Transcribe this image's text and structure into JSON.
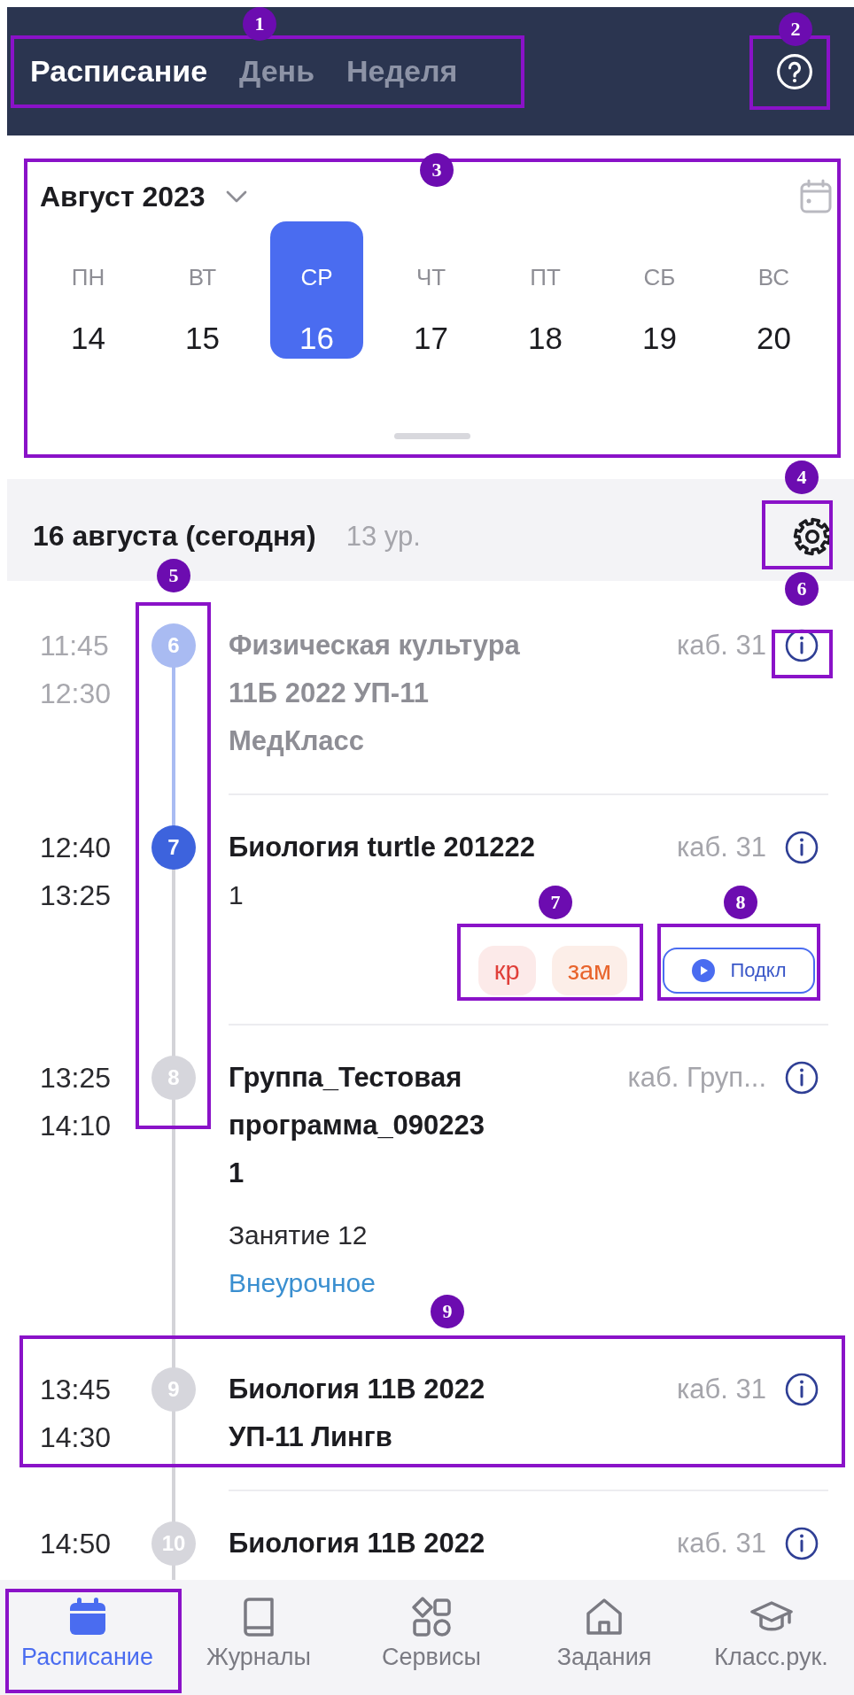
{
  "header": {
    "tabs": [
      {
        "label": "Расписание",
        "selected": true
      },
      {
        "label": "День",
        "selected": false
      },
      {
        "label": "Неделя",
        "selected": false
      }
    ]
  },
  "calendar": {
    "month": "Август 2023",
    "days": [
      {
        "weekday": "ПН",
        "date": "14",
        "selected": false
      },
      {
        "weekday": "ВТ",
        "date": "15",
        "selected": false
      },
      {
        "weekday": "СР",
        "date": "16",
        "selected": true
      },
      {
        "weekday": "ЧТ",
        "date": "17",
        "selected": false
      },
      {
        "weekday": "ПТ",
        "date": "18",
        "selected": false
      },
      {
        "weekday": "СБ",
        "date": "19",
        "selected": false
      },
      {
        "weekday": "ВС",
        "date": "20",
        "selected": false
      }
    ]
  },
  "day": {
    "title": "16 августа (сегодня)",
    "count": "13 ур."
  },
  "lessons": [
    {
      "start": "11:45",
      "end": "12:30",
      "number": "6",
      "completed": true,
      "current": false,
      "title": "Физическая культура\n11Б 2022 УП-11\nМедКласс",
      "room": "каб. 31"
    },
    {
      "start": "12:40",
      "end": "13:25",
      "number": "7",
      "completed": false,
      "current": true,
      "title": "Биология turtle 201222",
      "room": "каб. 31",
      "details": [
        {
          "kind": "note",
          "text": "1"
        }
      ],
      "tags": [
        {
          "label": "кр",
          "color": "#e0403a"
        },
        {
          "label": "зам",
          "color": "#e8642c"
        }
      ],
      "action": "Подкл"
    },
    {
      "start": "13:25",
      "end": "14:10",
      "number": "8",
      "completed": false,
      "current": false,
      "title": "Группа_Тестовая\nпрограмма_090223\n1",
      "room": "каб. Груп...",
      "details": [
        {
          "kind": "note",
          "text": "Занятие 12"
        },
        {
          "kind": "category",
          "text": "Внеурочное"
        }
      ]
    },
    {
      "start": "13:45",
      "end": "14:30",
      "number": "9",
      "completed": false,
      "current": false,
      "title": "Биология 11В 2022\nУП-11 Лингв",
      "room": "каб. 31"
    },
    {
      "start": "14:50",
      "number": "10",
      "completed": false,
      "current": false,
      "title": "Биология 11В 2022",
      "room": "каб. 31"
    }
  ],
  "nav": [
    {
      "label": "Расписание",
      "kind": "calendar",
      "selected": true
    },
    {
      "label": "Журналы",
      "kind": "book",
      "selected": false
    },
    {
      "label": "Сервисы",
      "kind": "grid",
      "selected": false
    },
    {
      "label": "Задания",
      "kind": "home",
      "selected": false
    },
    {
      "label": "Класс.рук.",
      "kind": "cap",
      "selected": false
    }
  ],
  "annotations": [
    {
      "kind": "numbered",
      "number": "1"
    },
    {
      "kind": "numbered",
      "number": "2"
    },
    {
      "kind": "numbered",
      "number": "3"
    },
    {
      "kind": "numbered",
      "number": "4"
    },
    {
      "kind": "numbered",
      "number": "5"
    },
    {
      "kind": "numbered",
      "number": "6"
    },
    {
      "kind": "numbered",
      "number": "7"
    },
    {
      "kind": "numbered",
      "number": "8"
    },
    {
      "kind": "numbered",
      "number": "9"
    },
    {
      "kind": "box"
    }
  ]
}
